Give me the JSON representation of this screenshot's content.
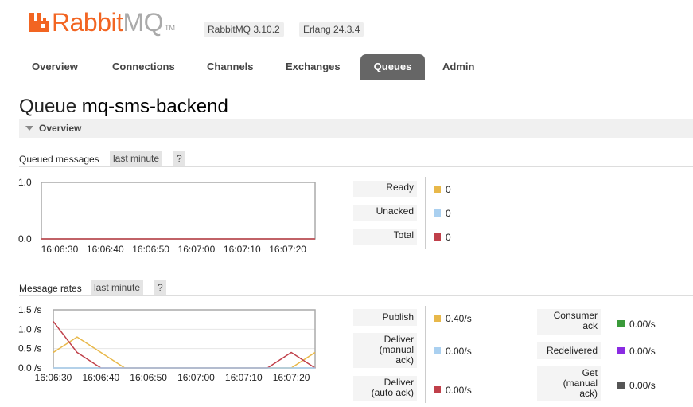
{
  "header": {
    "brand_rabbit": "Rabbit",
    "brand_mq": "MQ",
    "tm": "TM",
    "versions": [
      "RabbitMQ 3.10.2",
      "Erlang 24.3.4"
    ]
  },
  "tabs": [
    "Overview",
    "Connections",
    "Channels",
    "Exchanges",
    "Queues",
    "Admin"
  ],
  "active_tab": "Queues",
  "page": {
    "title_prefix": "Queue",
    "queue_name": "mq-sms-backend"
  },
  "section": {
    "label": "Overview"
  },
  "queued": {
    "heading": "Queued messages",
    "range": "last minute",
    "help": "?",
    "stats": [
      {
        "label": "Ready",
        "value": "0",
        "color": "#e8b84a"
      },
      {
        "label": "Unacked",
        "value": "0",
        "color": "#aad0f0"
      },
      {
        "label": "Total",
        "value": "0",
        "color": "#c0404a"
      }
    ]
  },
  "rates": {
    "heading": "Message rates",
    "range": "last minute",
    "help": "?",
    "left_stats": [
      {
        "label": "Publish",
        "value": "0.40/s",
        "color": "#e8b84a"
      },
      {
        "label": "Deliver (manual ack)",
        "value": "0.00/s",
        "color": "#aad0f0"
      },
      {
        "label": "Deliver (auto ack)",
        "value": "0.00/s",
        "color": "#c0404a"
      }
    ],
    "right_stats": [
      {
        "label": "Consumer ack",
        "value": "0.00/s",
        "color": "#3a9a3a"
      },
      {
        "label": "Redelivered",
        "value": "0.00/s",
        "color": "#8a2be2"
      },
      {
        "label": "Get (manual ack)",
        "value": "0.00/s",
        "color": "#555555"
      }
    ]
  },
  "chart_data": [
    {
      "type": "line",
      "x_ticks": [
        "16:06:30",
        "16:06:40",
        "16:06:50",
        "16:07:00",
        "16:07:10",
        "16:07:20"
      ],
      "y_ticks": [
        "0.0",
        "1.0"
      ],
      "ylim": [
        0,
        1
      ],
      "xlim": [
        "16:06:26",
        "16:07:26"
      ],
      "series": [
        {
          "color": "#e8b84a",
          "points": [
            [
              "16:06:26",
              0
            ],
            [
              "16:07:26",
              0
            ]
          ]
        },
        {
          "color": "#aad0f0",
          "points": [
            [
              "16:06:26",
              0
            ],
            [
              "16:07:26",
              0
            ]
          ]
        },
        {
          "color": "#c0404a",
          "points": [
            [
              "16:06:26",
              0
            ],
            [
              "16:07:26",
              0
            ]
          ]
        }
      ]
    },
    {
      "type": "line",
      "x_ticks": [
        "16:06:30",
        "16:06:40",
        "16:06:50",
        "16:07:00",
        "16:07:10",
        "16:07:20"
      ],
      "y_ticks": [
        "0.0 /s",
        "0.5 /s",
        "1.0 /s",
        "1.5 /s"
      ],
      "ylim": [
        0,
        1.5
      ],
      "xlim": [
        "16:06:30",
        "16:07:25"
      ],
      "series": [
        {
          "color": "#e8b84a",
          "points": [
            [
              "16:06:30",
              0.4
            ],
            [
              "16:06:35",
              0.8
            ],
            [
              "16:06:40",
              0.4
            ],
            [
              "16:06:45",
              0
            ],
            [
              "16:07:15",
              0
            ],
            [
              "16:07:20",
              0
            ],
            [
              "16:07:25",
              0.4
            ]
          ]
        },
        {
          "color": "#c0404a",
          "points": [
            [
              "16:06:30",
              1.2
            ],
            [
              "16:06:35",
              0.4
            ],
            [
              "16:06:40",
              0
            ],
            [
              "16:07:10",
              0
            ],
            [
              "16:07:15",
              0
            ],
            [
              "16:07:20",
              0.4
            ],
            [
              "16:07:25",
              0
            ]
          ]
        },
        {
          "color": "#aad0f0",
          "points": [
            [
              "16:06:30",
              0
            ],
            [
              "16:07:25",
              0
            ]
          ]
        }
      ]
    }
  ]
}
